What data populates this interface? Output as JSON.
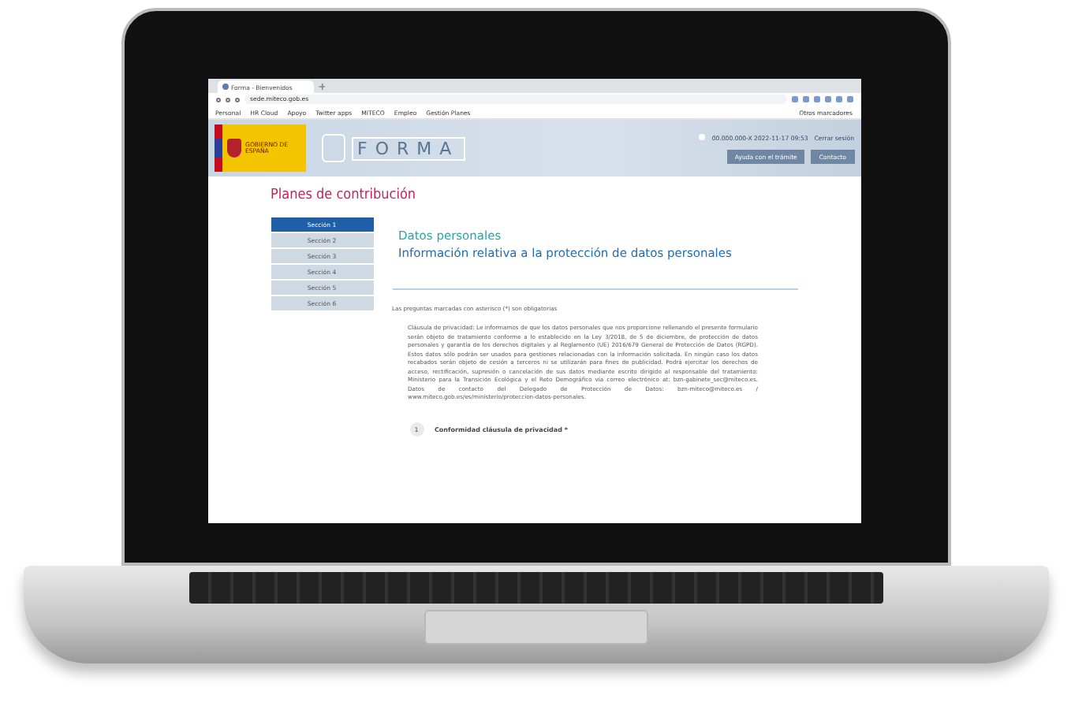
{
  "browser": {
    "tab": {
      "title": "Forma - Bienvenidos"
    },
    "address_bar": {
      "url": "sede.miteco.gob.es"
    },
    "bookmarks": [
      "Personal",
      "HR Cloud",
      "Apoyo",
      "Twitter apps",
      "MITECO",
      "Empleo",
      "Gestión Planes"
    ],
    "other_bookmarks": "Otros marcadores"
  },
  "header": {
    "logo_text": "GOBIERNO DE ESPAÑA",
    "app_name": "FORMA",
    "user": "00.000.000-X 2022-11-17 09:53",
    "logout": "Cerrar sesión",
    "buttons": [
      "Ayuda con el trámite",
      "Contacto"
    ]
  },
  "page_title": "Planes de contribución",
  "sidebar": {
    "items": [
      {
        "label": "Sección 1",
        "selected": true
      },
      {
        "label": "Sección 2",
        "selected": false
      },
      {
        "label": "Sección 3",
        "selected": false
      },
      {
        "label": "Sección 4",
        "selected": false
      },
      {
        "label": "Sección 5",
        "selected": false
      },
      {
        "label": "Sección 6",
        "selected": false
      }
    ]
  },
  "content": {
    "title": "Datos personales",
    "subtitle": "Información relativa a la protección de datos personales",
    "note": "Las preguntas marcadas con asterisco (*) son obligatorias",
    "paragraph": "Cláusula de privacidad: Le informamos de que los datos personales que nos proporcione rellenando el presente formulario serán objeto de tratamiento conforme a lo establecido en la Ley 3/2018, de 5 de diciembre, de protección de datos personales y garantía de los derechos digitales y al Reglamento (UE) 2016/679 General de Protección de Datos (RGPD). Estos datos sólo podrán ser usados para gestiones relacionadas con la información solicitada. En ningún caso los datos recabados serán objeto de cesión a terceros ni se utilizarán para fines de publicidad. Podrá ejercitar los derechos de acceso, rectificación, supresión o cancelación de sus datos mediante escrito dirigido al responsable del tratamiento: Ministerio para la Transición Ecológica y el Reto Demográfico vía correo electrónico at: bzn-gabinete_sec@miteco.es. Datos de contacto del Delegado de Protección de Datos: bzn-miteco@miteco.es / www.miteco.gob.es/es/ministerio/proteccion-datos-personales.",
    "question": {
      "number": "1",
      "label": "Conformidad cláusula de privacidad *"
    }
  }
}
